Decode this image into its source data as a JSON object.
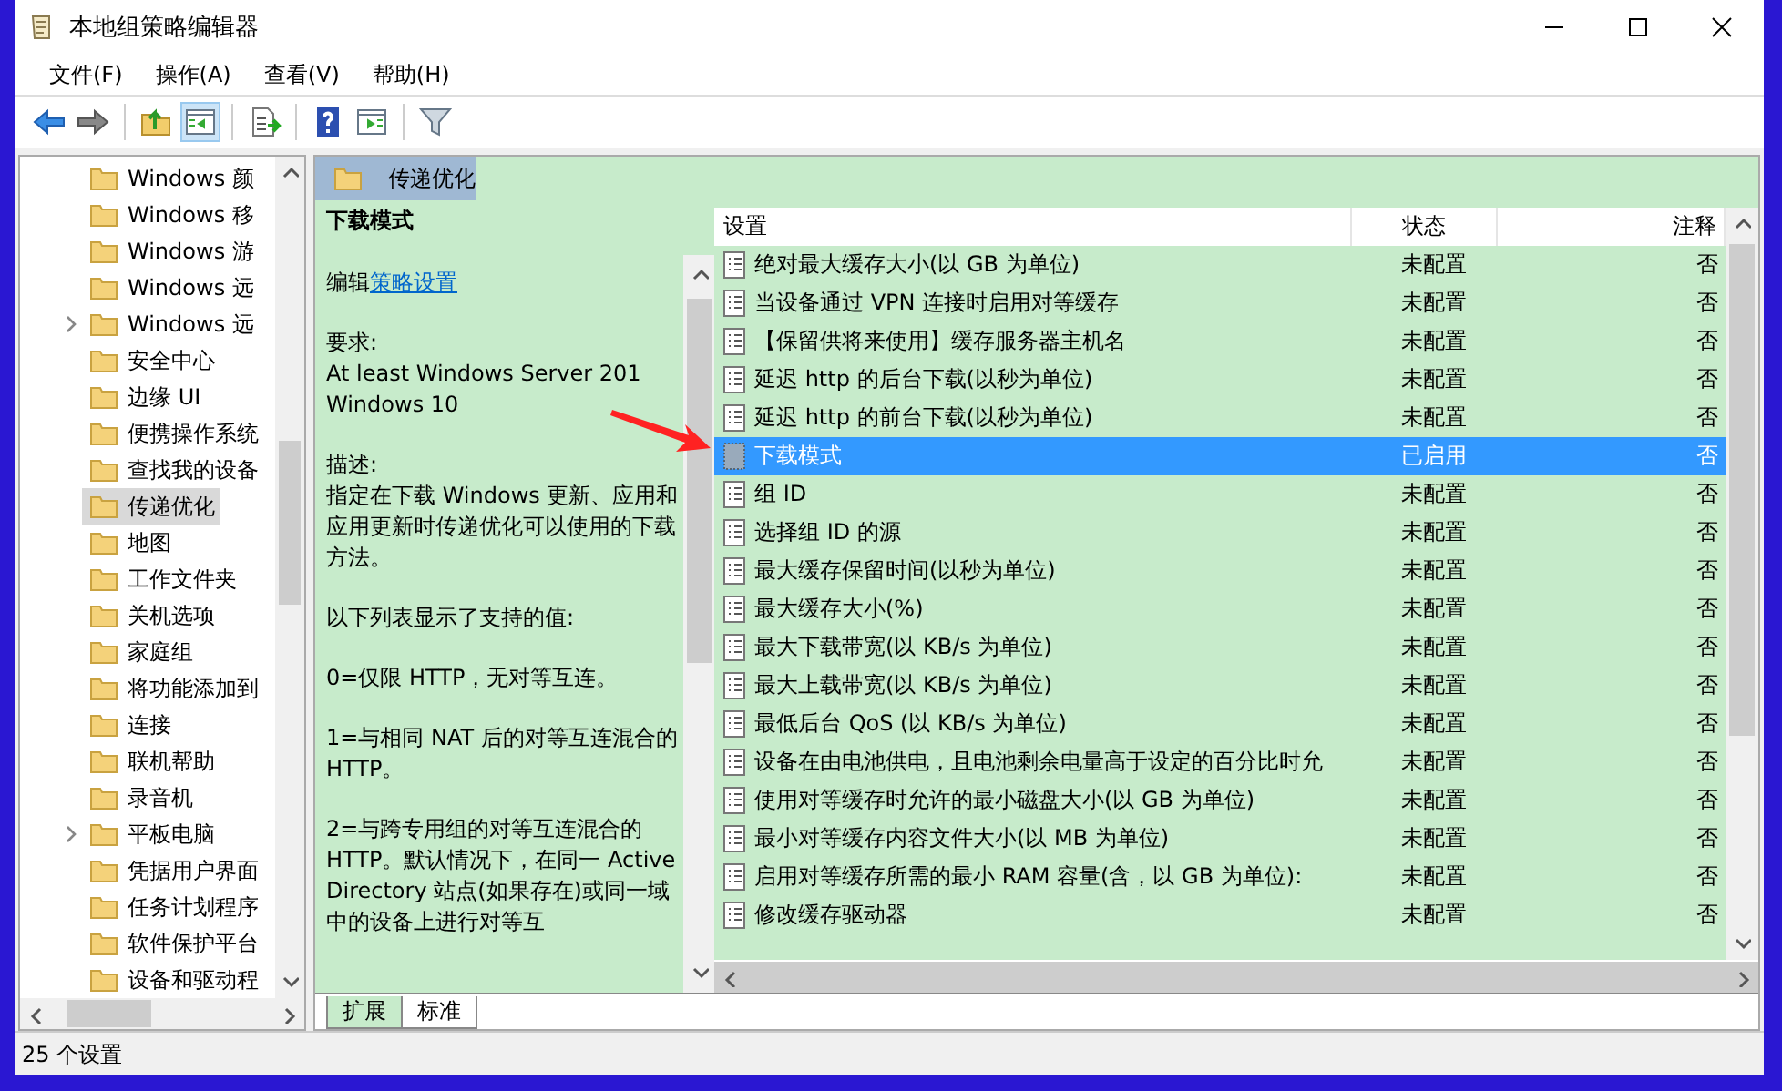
{
  "window": {
    "title": "本地组策略编辑器"
  },
  "menu": [
    {
      "label": "文件(F)"
    },
    {
      "label": "操作(A)"
    },
    {
      "label": "查看(V)"
    },
    {
      "label": "帮助(H)"
    }
  ],
  "toolbar": [
    {
      "kind": "back",
      "pressed": false
    },
    {
      "kind": "forward",
      "pressed": false
    },
    {
      "kind": "sep"
    },
    {
      "kind": "up",
      "pressed": false
    },
    {
      "kind": "tree",
      "pressed": true
    },
    {
      "kind": "sep"
    },
    {
      "kind": "export",
      "pressed": false
    },
    {
      "kind": "sep"
    },
    {
      "kind": "help",
      "pressed": false
    },
    {
      "kind": "panel",
      "pressed": false
    },
    {
      "kind": "sep"
    },
    {
      "kind": "filter",
      "pressed": false
    }
  ],
  "tree": {
    "items": [
      {
        "label": "Windows 颜",
        "expandable": false,
        "selected": false
      },
      {
        "label": "Windows 移",
        "expandable": false,
        "selected": false
      },
      {
        "label": "Windows 游",
        "expandable": false,
        "selected": false
      },
      {
        "label": "Windows 远",
        "expandable": false,
        "selected": false
      },
      {
        "label": "Windows 远",
        "expandable": true,
        "selected": false
      },
      {
        "label": "安全中心",
        "expandable": false,
        "selected": false
      },
      {
        "label": "边缘 UI",
        "expandable": false,
        "selected": false
      },
      {
        "label": "便携操作系统",
        "expandable": false,
        "selected": false
      },
      {
        "label": "查找我的设备",
        "expandable": false,
        "selected": false
      },
      {
        "label": "传递优化",
        "expandable": false,
        "selected": true
      },
      {
        "label": "地图",
        "expandable": false,
        "selected": false
      },
      {
        "label": "工作文件夹",
        "expandable": false,
        "selected": false
      },
      {
        "label": "关机选项",
        "expandable": false,
        "selected": false
      },
      {
        "label": "家庭组",
        "expandable": false,
        "selected": false
      },
      {
        "label": "将功能添加到",
        "expandable": false,
        "selected": false
      },
      {
        "label": "连接",
        "expandable": false,
        "selected": false
      },
      {
        "label": "联机帮助",
        "expandable": false,
        "selected": false
      },
      {
        "label": "录音机",
        "expandable": false,
        "selected": false
      },
      {
        "label": "平板电脑",
        "expandable": true,
        "selected": false
      },
      {
        "label": "凭据用户界面",
        "expandable": false,
        "selected": false
      },
      {
        "label": "任务计划程序",
        "expandable": false,
        "selected": false
      },
      {
        "label": "软件保护平台",
        "expandable": false,
        "selected": false
      },
      {
        "label": "设备和驱动程",
        "expandable": false,
        "selected": false
      }
    ]
  },
  "folder_header": {
    "title": "传递优化"
  },
  "description": {
    "title": "下载模式",
    "edit_prefix": "编辑",
    "edit_link": "策略设置",
    "paragraphs": [
      "要求:\nAt least Windows Server 201\nWindows 10",
      "描述:\n指定在下载 Windows 更新、应用和应用更新时传递优化可以使用的下载方法。",
      "以下列表显示了支持的值:",
      "0=仅限 HTTP，无对等互连。",
      "1=与相同 NAT 后的对等互连混合的 HTTP。",
      "2=与跨专用组的对等互连混合的 HTTP。默认情况下，在同一 Active Directory 站点(如果存在)或同一域中的设备上进行对等互"
    ]
  },
  "table": {
    "columns": [
      {
        "label": "设置"
      },
      {
        "label": "状态"
      },
      {
        "label": "注释"
      }
    ],
    "rows": [
      {
        "name": "绝对最大缓存大小(以 GB 为单位)",
        "state": "未配置",
        "comment": "否",
        "selected": false
      },
      {
        "name": "当设备通过 VPN 连接时启用对等缓存",
        "state": "未配置",
        "comment": "否",
        "selected": false
      },
      {
        "name": "【保留供将来使用】缓存服务器主机名",
        "state": "未配置",
        "comment": "否",
        "selected": false
      },
      {
        "name": "延迟 http 的后台下载(以秒为单位)",
        "state": "未配置",
        "comment": "否",
        "selected": false
      },
      {
        "name": "延迟 http 的前台下载(以秒为单位)",
        "state": "未配置",
        "comment": "否",
        "selected": false
      },
      {
        "name": "下载模式",
        "state": "已启用",
        "comment": "否",
        "selected": true
      },
      {
        "name": "组 ID",
        "state": "未配置",
        "comment": "否",
        "selected": false
      },
      {
        "name": "选择组 ID 的源",
        "state": "未配置",
        "comment": "否",
        "selected": false
      },
      {
        "name": "最大缓存保留时间(以秒为单位)",
        "state": "未配置",
        "comment": "否",
        "selected": false
      },
      {
        "name": "最大缓存大小(%)",
        "state": "未配置",
        "comment": "否",
        "selected": false
      },
      {
        "name": "最大下载带宽(以 KB/s 为单位)",
        "state": "未配置",
        "comment": "否",
        "selected": false
      },
      {
        "name": "最大上载带宽(以 KB/s 为单位)",
        "state": "未配置",
        "comment": "否",
        "selected": false
      },
      {
        "name": "最低后台 QoS (以 KB/s 为单位)",
        "state": "未配置",
        "comment": "否",
        "selected": false
      },
      {
        "name": "设备在由电池供电，且电池剩余电量高于设定的百分比时允",
        "state": "未配置",
        "comment": "否",
        "selected": false
      },
      {
        "name": "使用对等缓存时允许的最小磁盘大小(以 GB 为单位)",
        "state": "未配置",
        "comment": "否",
        "selected": false
      },
      {
        "name": "最小对等缓存内容文件大小(以 MB 为单位)",
        "state": "未配置",
        "comment": "否",
        "selected": false
      },
      {
        "name": "启用对等缓存所需的最小 RAM 容量(含，以 GB 为单位):",
        "state": "未配置",
        "comment": "否",
        "selected": false
      },
      {
        "name": "修改缓存驱动器",
        "state": "未配置",
        "comment": "否",
        "selected": false
      }
    ]
  },
  "tabs": [
    {
      "label": "扩展",
      "selected": true
    },
    {
      "label": "标准",
      "selected": false
    }
  ],
  "status_bar": {
    "text": "25 个设置"
  }
}
